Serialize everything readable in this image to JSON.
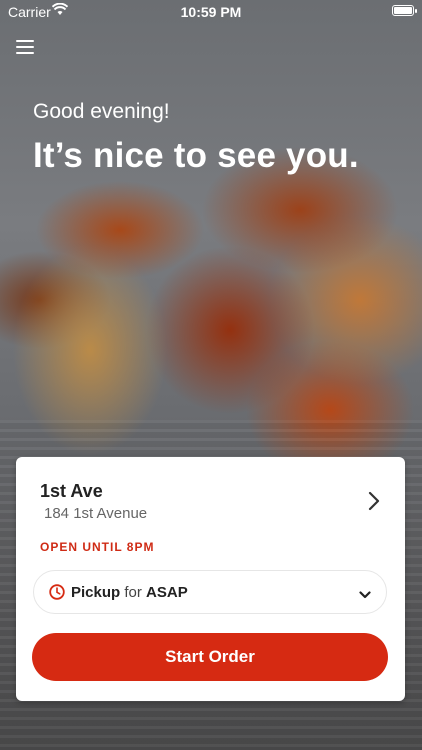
{
  "status_bar": {
    "carrier": "Carrier",
    "time": "10:59 PM"
  },
  "header": {
    "greeting": "Good evening!",
    "headline": "It’s nice to see you."
  },
  "location": {
    "name": "1st Ave",
    "address": "184 1st Avenue",
    "hours": "OPEN UNTIL 8PM"
  },
  "pickup": {
    "mode": "Pickup",
    "connector": "for",
    "time": "ASAP"
  },
  "cta": {
    "label": "Start Order"
  },
  "colors": {
    "accent": "#d62a12",
    "hours_text": "#cf2b15"
  },
  "icons": [
    "wifi-icon",
    "battery-icon",
    "hamburger-menu-icon",
    "chevron-right-icon",
    "clock-icon",
    "chevron-down-icon"
  ]
}
